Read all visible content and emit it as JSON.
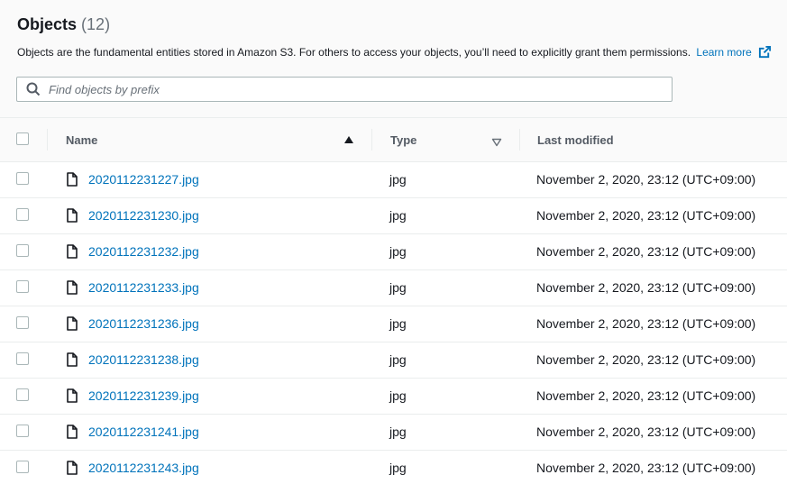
{
  "objects": {
    "title": "Objects",
    "count": "(12)",
    "description": "Objects are the fundamental entities stored in Amazon S3. For others to access your objects, you’ll need to explicitly grant them permissions.",
    "learn_more": "Learn more"
  },
  "search": {
    "placeholder": "Find objects by prefix"
  },
  "table": {
    "columns": {
      "name": "Name",
      "type": "Type",
      "last_modified": "Last modified"
    },
    "sort": {
      "column": "Name",
      "direction": "ascending"
    },
    "rows": [
      {
        "name": "2020112231227.jpg",
        "type": "jpg",
        "last_modified": "November 2, 2020, 23:12 (UTC+09:00)"
      },
      {
        "name": "2020112231230.jpg",
        "type": "jpg",
        "last_modified": "November 2, 2020, 23:12 (UTC+09:00)"
      },
      {
        "name": "2020112231232.jpg",
        "type": "jpg",
        "last_modified": "November 2, 2020, 23:12 (UTC+09:00)"
      },
      {
        "name": "2020112231233.jpg",
        "type": "jpg",
        "last_modified": "November 2, 2020, 23:12 (UTC+09:00)"
      },
      {
        "name": "2020112231236.jpg",
        "type": "jpg",
        "last_modified": "November 2, 2020, 23:12 (UTC+09:00)"
      },
      {
        "name": "2020112231238.jpg",
        "type": "jpg",
        "last_modified": "November 2, 2020, 23:12 (UTC+09:00)"
      },
      {
        "name": "2020112231239.jpg",
        "type": "jpg",
        "last_modified": "November 2, 2020, 23:12 (UTC+09:00)"
      },
      {
        "name": "2020112231241.jpg",
        "type": "jpg",
        "last_modified": "November 2, 2020, 23:12 (UTC+09:00)"
      },
      {
        "name": "2020112231243.jpg",
        "type": "jpg",
        "last_modified": "November 2, 2020, 23:12 (UTC+09:00)"
      }
    ]
  },
  "icons": {
    "search": "search-icon",
    "external_link": "external-link-icon",
    "file": "file-icon",
    "sort_ascending": "sort-ascending-icon",
    "sort_none": "sort-none-icon"
  },
  "colors": {
    "link": "#0073bb",
    "text": "#16191f",
    "muted": "#687078",
    "header_bg": "#fafafa",
    "border": "#eaeded"
  }
}
